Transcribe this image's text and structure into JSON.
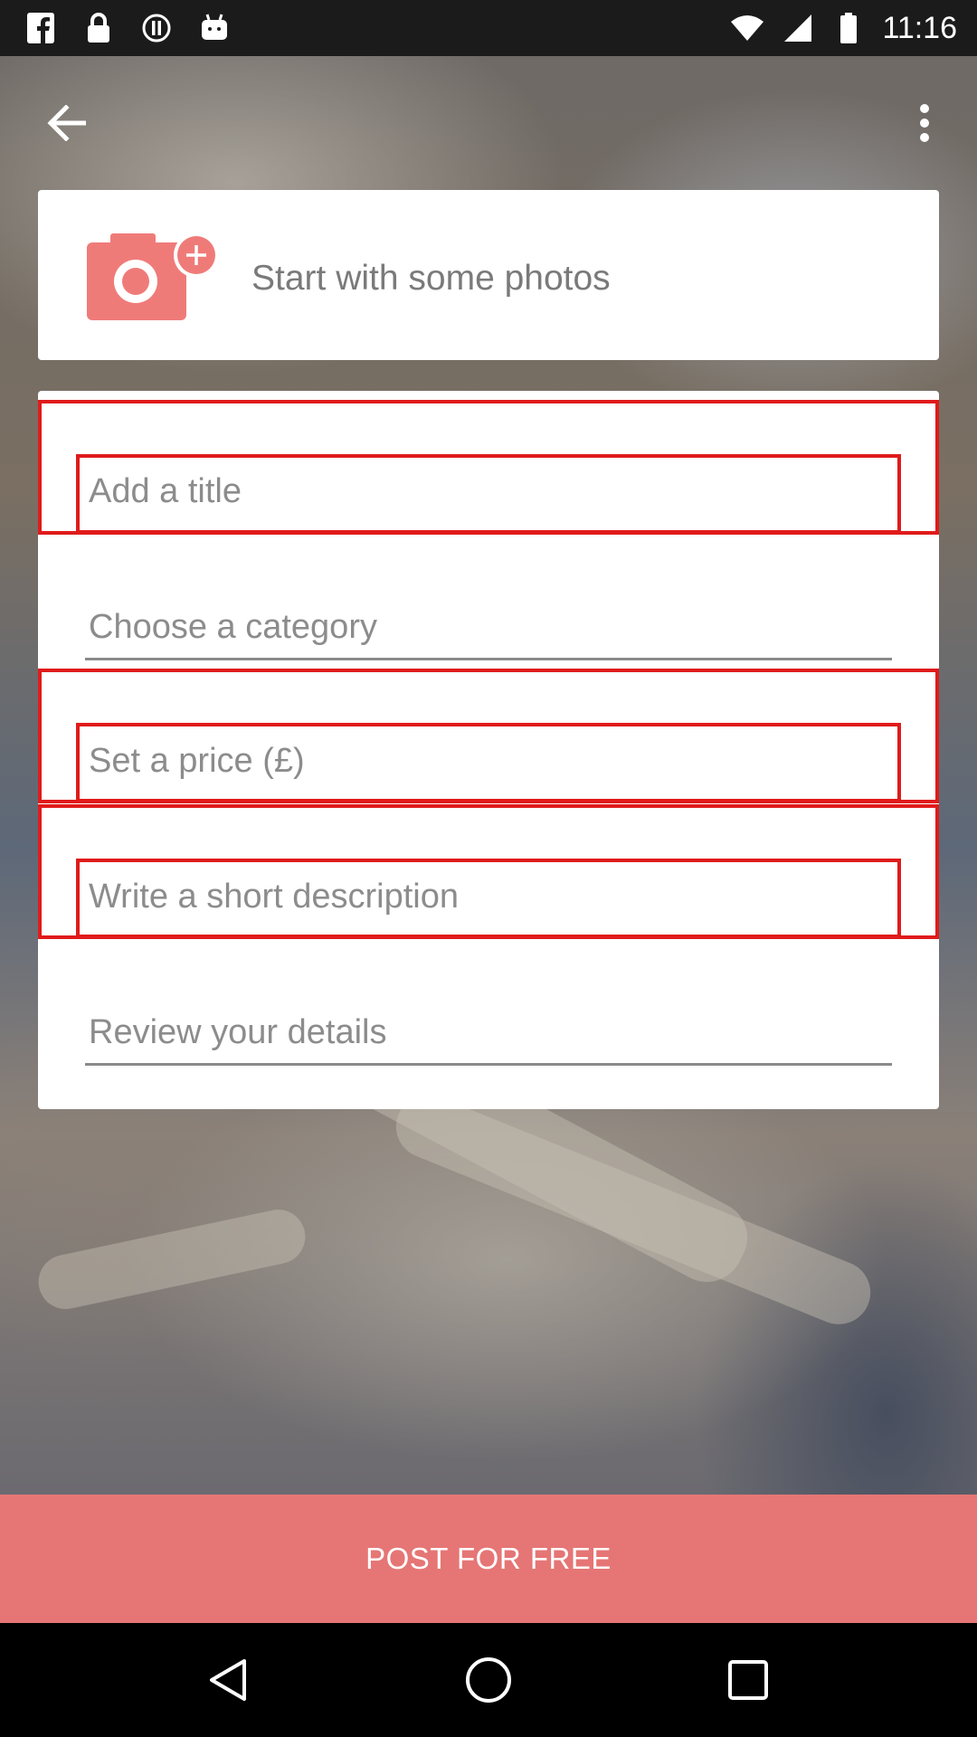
{
  "status_bar": {
    "time": "11:16",
    "left_icons": [
      "facebook-icon",
      "lock-icon",
      "info-circle-icon",
      "android-icon"
    ],
    "right_icons": [
      "wifi-icon",
      "signal-icon",
      "battery-icon"
    ]
  },
  "app_bar": {
    "back_icon": "arrow-back-icon",
    "menu_icon": "more-vert-icon"
  },
  "photo_card": {
    "icon": "add-photo-camera-icon",
    "label": "Start with some photos"
  },
  "form": {
    "title_placeholder": "Add a title",
    "category_placeholder": "Choose a category",
    "price_placeholder": "Set a price (£)",
    "description_placeholder": "Write a short description",
    "review_label": "Review your details"
  },
  "post_button": {
    "label": "POST FOR FREE"
  },
  "colors": {
    "accent": "#e57675",
    "highlight": "#e01b1b"
  },
  "nav_bar": {
    "icons": [
      "back-triangle-icon",
      "home-circle-icon",
      "recents-square-icon"
    ]
  }
}
